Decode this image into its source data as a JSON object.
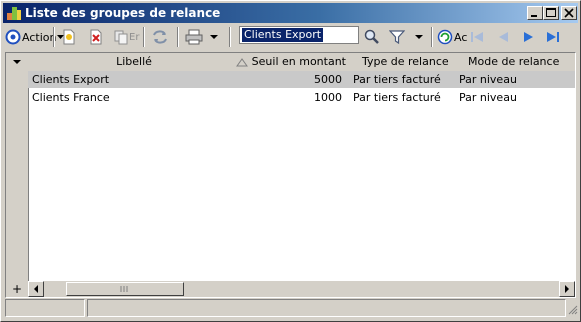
{
  "window": {
    "title": "Liste des groupes de relance"
  },
  "toolbar": {
    "action_label": "Action",
    "copy_label": "Er",
    "search_value": "Clients Export",
    "actualiser_label": "Ac"
  },
  "grid": {
    "columns": [
      {
        "label": "Libellé"
      },
      {
        "label": "Seuil en montant"
      },
      {
        "label": "Type de relance"
      },
      {
        "label": "Mode de relance"
      }
    ],
    "rows": [
      {
        "libelle": "Clients Export",
        "seuil": "5000",
        "type": "Par tiers facturé",
        "mode": "Par niveau"
      },
      {
        "libelle": "Clients France",
        "seuil": "1000",
        "type": "Par tiers facturé",
        "mode": "Par niveau"
      }
    ],
    "add_row_symbol": "+"
  },
  "colors": {
    "title_start": "#0a246a",
    "title_end": "#a6caf0",
    "selected_row": "#c9c9c9",
    "nav_blue": "#2a6fd6",
    "nav_disabled": "#a9bbd9"
  }
}
